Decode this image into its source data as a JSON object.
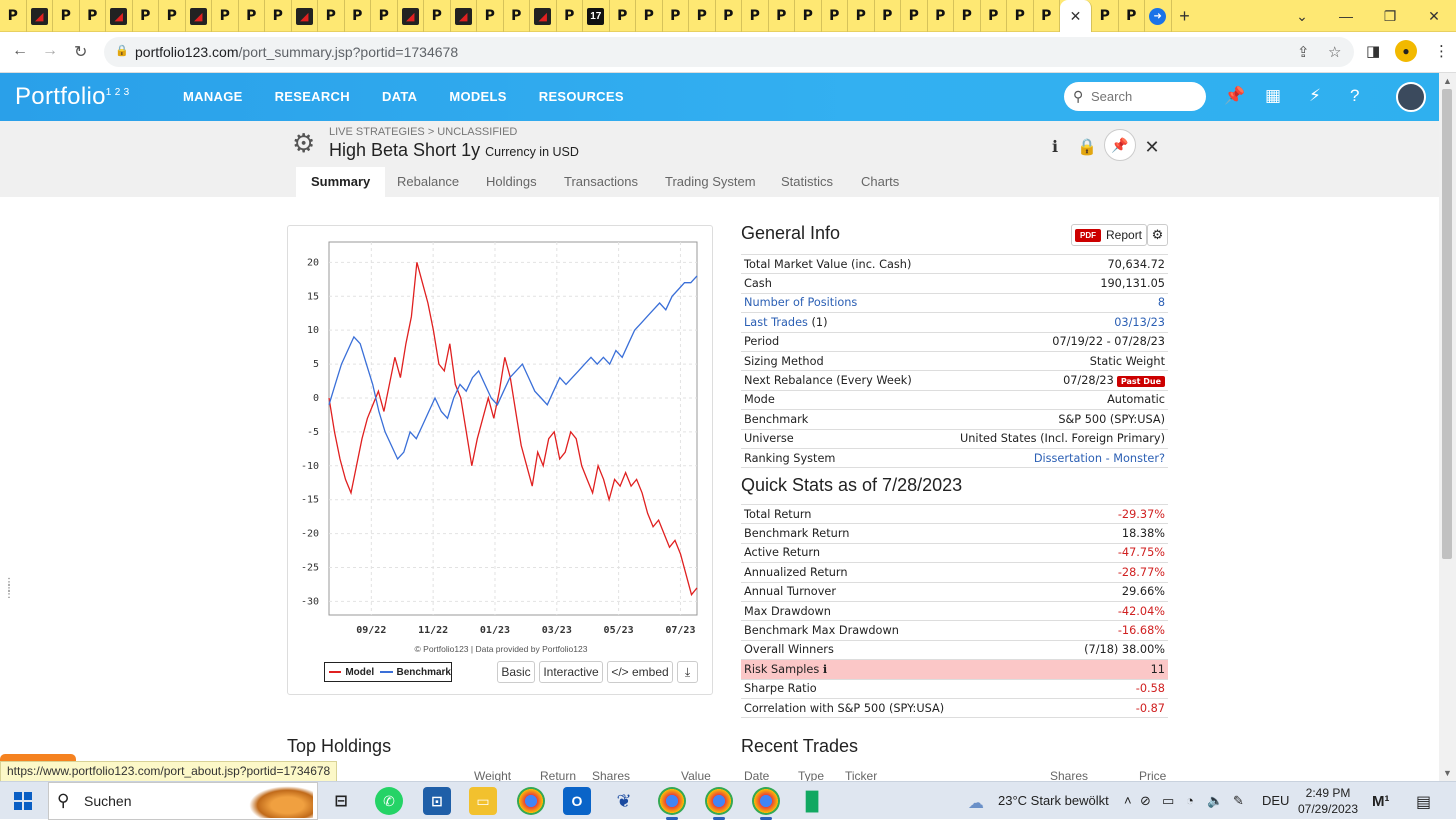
{
  "browser": {
    "tab_favicons": [
      "p",
      "r",
      "p",
      "p",
      "r",
      "p",
      "p",
      "r",
      "p",
      "p",
      "p",
      "r",
      "p",
      "p",
      "p",
      "r",
      "p",
      "r",
      "p",
      "p",
      "r",
      "p",
      "tv",
      "p",
      "p",
      "p",
      "p",
      "p",
      "p",
      "p",
      "p",
      "p",
      "p",
      "p",
      "p",
      "p",
      "p",
      "p",
      "p",
      "p",
      "p",
      "p"
    ],
    "active_tab_close": "✕",
    "new_tab": "+",
    "address_host": "portfolio123.com",
    "address_path": "/port_summary.jsp?portid=1734678",
    "status_url": "https://www.portfolio123.com/port_about.jsp?portid=1734678"
  },
  "app": {
    "logo": "Portfolio",
    "logo_sup": "1 2 3",
    "nav": [
      "MANAGE",
      "RESEARCH",
      "DATA",
      "MODELS",
      "RESOURCES"
    ],
    "search_placeholder": "Search"
  },
  "portfolio": {
    "breadcrumb": "LIVE STRATEGIES > UNCLASSIFIED",
    "title": "High Beta Short 1y",
    "currency": "Currency in USD",
    "tabs": [
      "Summary",
      "Rebalance",
      "Holdings",
      "Transactions",
      "Trading System",
      "Statistics",
      "Charts"
    ]
  },
  "chart": {
    "copyright": "© Portfolio123 | Data provided by Portfolio123",
    "legend_model": "Model",
    "legend_benchmark": "Benchmark",
    "btn_basic": "Basic",
    "btn_interactive": "Interactive",
    "btn_embed": "</> embed",
    "download_icon": "download-icon"
  },
  "chart_data": {
    "type": "line",
    "x_ticks": [
      "09/22",
      "11/22",
      "01/23",
      "03/23",
      "05/23",
      "07/23"
    ],
    "y_ticks": [
      20,
      15,
      10,
      5,
      0,
      -5,
      -10,
      -15,
      -20,
      -25,
      -30
    ],
    "ylim": [
      -32,
      23
    ],
    "grid": true,
    "legend_position": "bottom-left",
    "colors": {
      "Model": "#e02020",
      "Benchmark": "#3a6fd8"
    },
    "series": [
      {
        "name": "Model",
        "values": [
          0,
          -5,
          -9,
          -12,
          -14,
          -10,
          -6,
          -3,
          -1,
          1,
          -2,
          2,
          6,
          3,
          8,
          12,
          20,
          17,
          14,
          10,
          5,
          4,
          8,
          2,
          0,
          -5,
          -10,
          -6,
          -3,
          0,
          -3,
          1,
          6,
          3,
          -2,
          -7,
          -10,
          -13,
          -8,
          -10,
          -6,
          -5,
          -9,
          -8,
          -5,
          -6,
          -10,
          -12,
          -14,
          -10,
          -12,
          -15,
          -12,
          -13,
          -11,
          -13,
          -12,
          -14,
          -17,
          -19,
          -18,
          -20,
          -22,
          -21,
          -23,
          -26,
          -29,
          -28
        ]
      },
      {
        "name": "Benchmark",
        "values": [
          -1,
          2,
          5,
          7,
          9,
          8,
          5,
          2,
          -2,
          -5,
          -7,
          -9,
          -8,
          -5,
          -6,
          -4,
          -2,
          0,
          -2,
          -3,
          0,
          2,
          1,
          3,
          4,
          2,
          0,
          -1,
          1,
          3,
          4,
          5,
          3,
          1,
          0,
          -1,
          1,
          3,
          2,
          3,
          4,
          5,
          6,
          5,
          6,
          5,
          7,
          6,
          8,
          10,
          11,
          12,
          13,
          14,
          13,
          15,
          16,
          17,
          17,
          18
        ]
      }
    ]
  },
  "general_info": {
    "title": "General Info",
    "report_badge": "PDF",
    "report_label": "Report",
    "rows": [
      {
        "label": "Total Market Value (inc. Cash)",
        "value": "70,634.72"
      },
      {
        "label": "Cash",
        "value": "190,131.05"
      },
      {
        "label": "Number of Positions",
        "value": "8"
      },
      {
        "label": "Last Trades",
        "label_suffix": " (1)",
        "value": "03/13/23"
      },
      {
        "label": "Period",
        "value": "07/19/22 - 07/28/23"
      },
      {
        "label": "Sizing Method",
        "value": "Static Weight"
      },
      {
        "label": "Next Rebalance (Every Week)",
        "value": "07/28/23",
        "badge": "Past Due"
      },
      {
        "label": "Mode",
        "value": "Automatic"
      },
      {
        "label": "Benchmark",
        "value": "S&P 500 (SPY:USA)"
      },
      {
        "label": "Universe",
        "value": "United States (Incl. Foreign Primary)"
      },
      {
        "label": "Ranking System",
        "value": "Dissertation - Monster?"
      }
    ]
  },
  "quick_stats": {
    "title": "Quick Stats as of 7/28/2023",
    "rows": [
      {
        "label": "Total Return",
        "value": "-29.37%"
      },
      {
        "label": "Benchmark Return",
        "value": "18.38%"
      },
      {
        "label": "Active Return",
        "value": "-47.75%"
      },
      {
        "label": "Annualized Return",
        "value": "-28.77%"
      },
      {
        "label": "Annual Turnover",
        "value": "29.66%"
      },
      {
        "label": "Max Drawdown",
        "value": "-42.04%"
      },
      {
        "label": "Benchmark Max Drawdown",
        "value": "-16.68%"
      },
      {
        "label": "Overall Winners",
        "value": "(7/18) 38.00%"
      },
      {
        "label": "Risk Samples",
        "value": "11"
      },
      {
        "label": "Sharpe Ratio",
        "value": "-0.58"
      },
      {
        "label": "Correlation with S&P 500 (SPY:USA)",
        "value": "-0.87"
      }
    ]
  },
  "top_holdings": {
    "title": "Top Holdings",
    "cols": [
      "ker",
      "Weight",
      "Return",
      "Shares",
      "Value"
    ]
  },
  "recent_trades": {
    "title": "Recent Trades",
    "cols": [
      "Date",
      "Type",
      "Ticker",
      "Shares",
      "Price"
    ]
  },
  "taskbar": {
    "search_label": "Suchen",
    "weather": "23°C  Stark bewölkt",
    "lang": "DEU",
    "time": "2:49 PM",
    "date": "07/29/2023"
  }
}
